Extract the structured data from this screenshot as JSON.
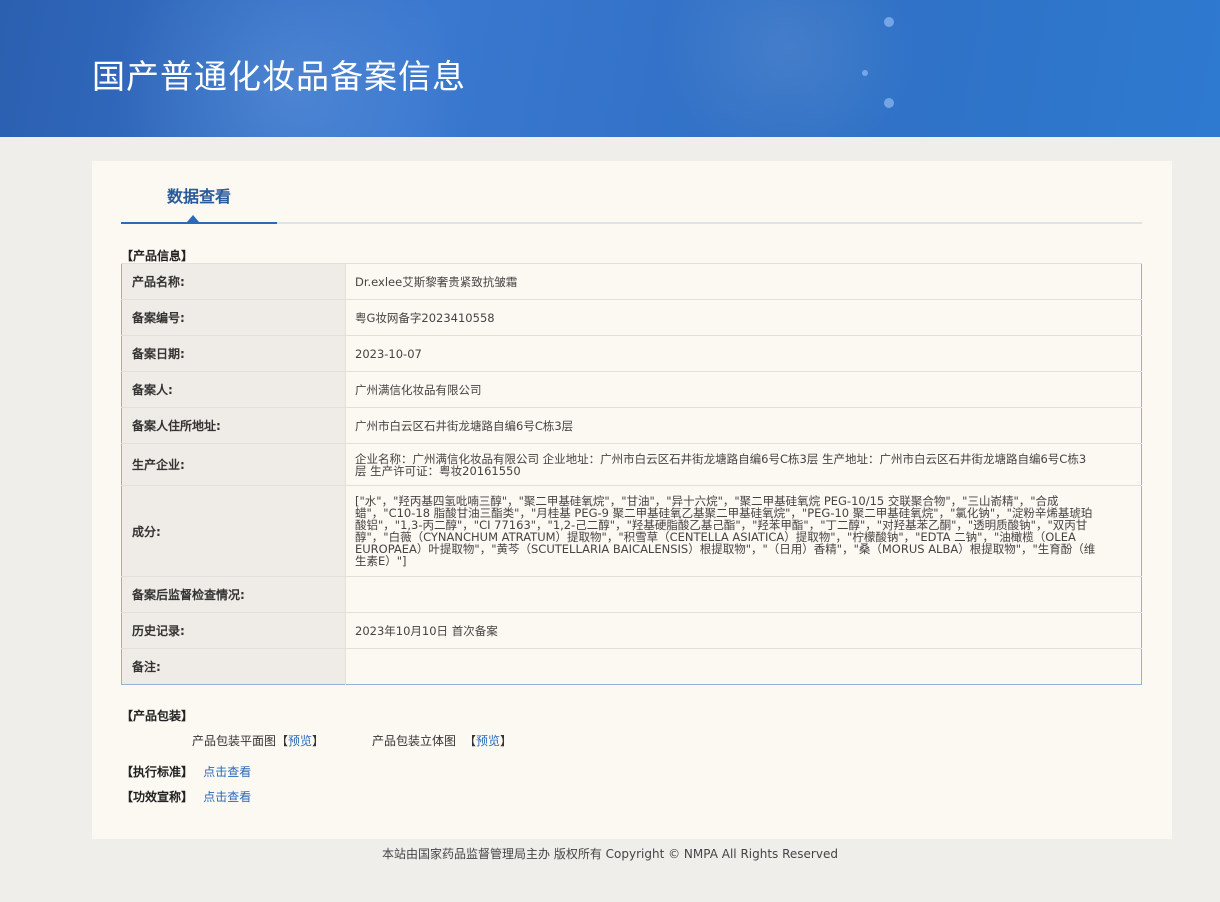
{
  "header": {
    "title": "国产普通化妆品备案信息"
  },
  "tabs": [
    {
      "label": "数据查看"
    }
  ],
  "product_info": {
    "section_label": "【产品信息】",
    "rows": [
      {
        "label": "产品名称:",
        "value": "Dr.exlee艾斯黎奢贵紧致抗皱霜"
      },
      {
        "label": "备案编号:",
        "value": "粤G妆网备字2023410558"
      },
      {
        "label": "备案日期:",
        "value": "2023-10-07"
      },
      {
        "label": "备案人:",
        "value": "广州满信化妆品有限公司"
      },
      {
        "label": "备案人住所地址:",
        "value": "广州市白云区石井街龙塘路自编6号C栋3层"
      },
      {
        "label": "生产企业:",
        "value": "企业名称：广州满信化妆品有限公司 企业地址：广州市白云区石井街龙塘路自编6号C栋3层 生产地址：广州市白云区石井街龙塘路自编6号C栋3层 生产许可证：粤妆20161550"
      },
      {
        "label": "成分:",
        "value": "[\"水\"，\"羟丙基四氢吡喃三醇\"，\"聚二甲基硅氧烷\"，\"甘油\"，\"异十六烷\"，\"聚二甲基硅氧烷 PEG-10/15 交联聚合物\"，\"三山嵛精\"，\"合成蜡\"，\"C10-18 脂酸甘油三酯类\"，\"月桂基 PEG-9 聚二甲基硅氧乙基聚二甲基硅氧烷\"，\"PEG-10 聚二甲基硅氧烷\"，\"氯化钠\"，\"淀粉辛烯基琥珀酸铝\"，\"1,3-丙二醇\"，\"CI 77163\"，\"1,2-己二醇\"，\"羟基硬脂酸乙基己酯\"，\"羟苯甲酯\"，\"丁二醇\"，\"对羟基苯乙酮\"，\"透明质酸钠\"，\"双丙甘醇\"，\"白薇（CYNANCHUM ATRATUM）提取物\"，\"积雪草（CENTELLA ASIATICA）提取物\"，\"柠檬酸钠\"，\"EDTA 二钠\"，\"油橄榄（OLEA EUROPAEA）叶提取物\"，\"黄芩（SCUTELLARIA BAICALENSIS）根提取物\"，\"（日用）香精\"，\"桑（MORUS ALBA）根提取物\"，\"生育酚（维生素E）\"]"
      },
      {
        "label": "备案后监督检查情况:",
        "value": ""
      },
      {
        "label": "历史记录:",
        "value": "2023年10月10日 首次备案"
      },
      {
        "label": "备注:",
        "value": ""
      }
    ]
  },
  "packaging": {
    "section_label": "【产品包装】",
    "flat_label": "产品包装平面图",
    "solid_label": "产品包装立体图",
    "bracket_open": "【",
    "bracket_close": "】",
    "preview_link": "预览"
  },
  "standard": {
    "label": "【执行标准】",
    "link": "点击查看"
  },
  "efficacy": {
    "label": "【功效宣称】",
    "link": "点击查看"
  },
  "footer": {
    "text": "本站由国家药品监督管理局主办 版权所有 Copyright © NMPA All Rights Reserved"
  },
  "colors": {
    "banner": "#2f6fc4",
    "link": "#2a6ab8",
    "tab_active": "#2a5a9b",
    "panel_bg": "#fcf8f2",
    "page_bg": "#f0eeeb"
  }
}
